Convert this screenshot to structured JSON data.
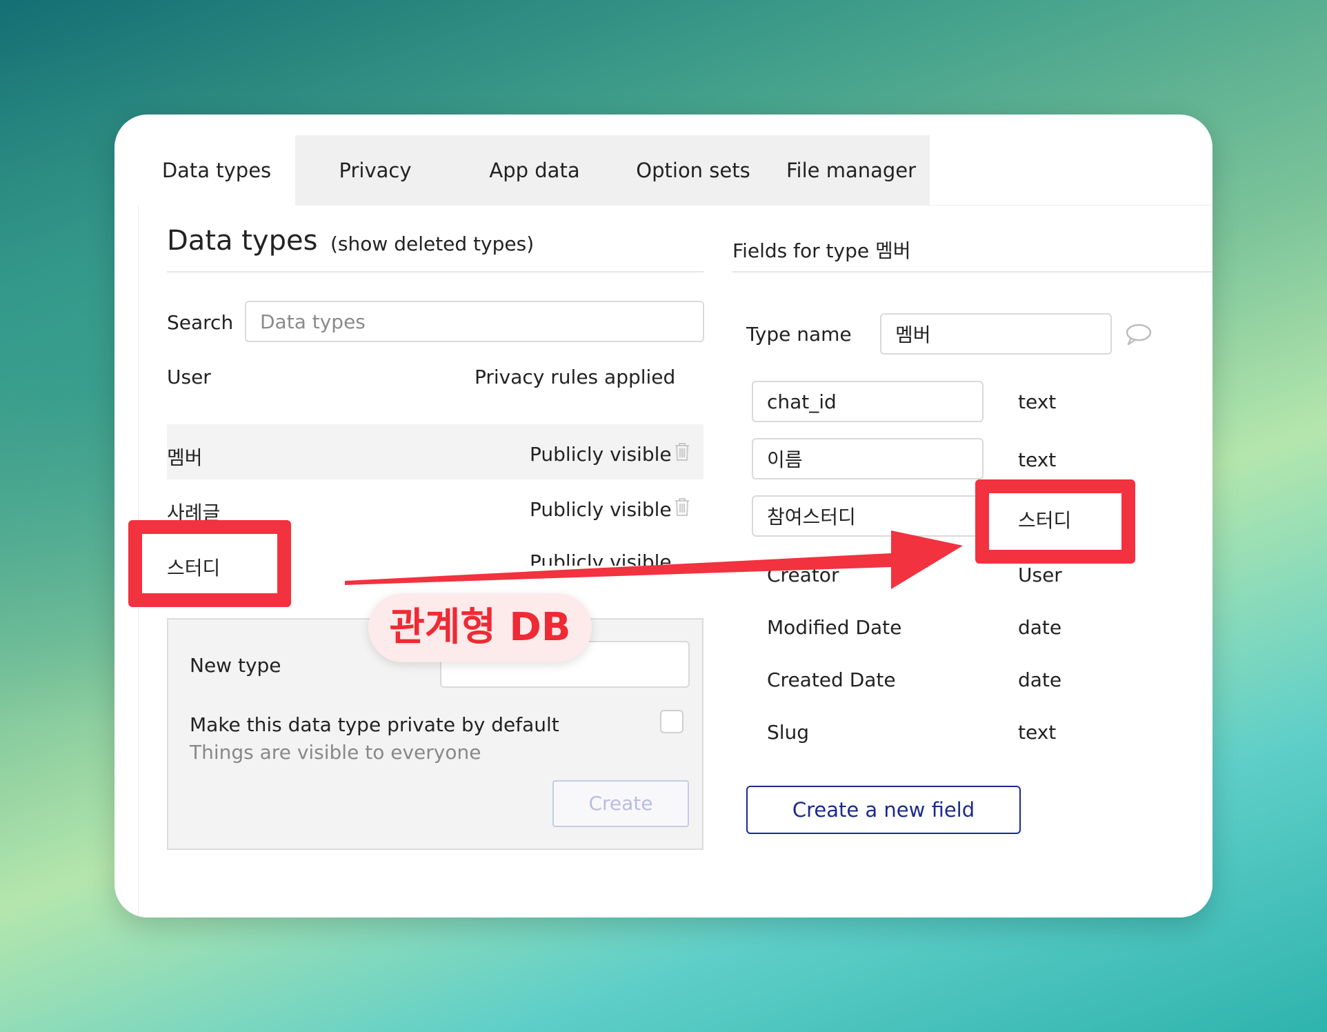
{
  "tabs": [
    {
      "label": "Data types"
    },
    {
      "label": "Privacy"
    },
    {
      "label": "App data"
    },
    {
      "label": "Option sets"
    },
    {
      "label": "File manager"
    }
  ],
  "left": {
    "title": "Data types",
    "show_deleted": "(show deleted types)",
    "search_label": "Search",
    "search_placeholder": "Data types",
    "types": [
      {
        "name": "User",
        "status": "Privacy rules applied"
      },
      {
        "name": "멤버",
        "status": "Publicly visible"
      },
      {
        "name": "사례글",
        "status": "Publicly visible"
      },
      {
        "name": "스터디",
        "status": "Publicly visible"
      }
    ],
    "new_type": {
      "label": "New type",
      "value": "",
      "private_label": "Make this data type private by default",
      "private_note": "Things are visible to everyone",
      "create_label": "Create"
    }
  },
  "right": {
    "header": "Fields for type 멤버",
    "type_name_label": "Type name",
    "type_name_value": "멤버",
    "fields": [
      {
        "name": "chat_id",
        "type": "text"
      },
      {
        "name": "이름",
        "type": "text"
      },
      {
        "name": "참여스터디",
        "type": "스터디"
      },
      {
        "name": "Creator",
        "type": "User"
      },
      {
        "name": "Modified Date",
        "type": "date"
      },
      {
        "name": "Created Date",
        "type": "date"
      },
      {
        "name": "Slug",
        "type": "text"
      }
    ],
    "new_field_label": "Create a new field"
  },
  "annotation": {
    "label": "관계형 DB",
    "color": "#f2323f"
  },
  "colors": {
    "accent": "#1a2a8c",
    "highlight": "#f2323f"
  }
}
